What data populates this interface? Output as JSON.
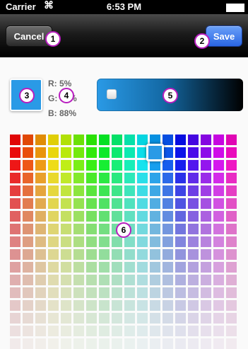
{
  "status_bar": {
    "carrier": "Carrier",
    "time": "6:53 PM"
  },
  "navbar": {
    "cancel_label": "Cancel",
    "save_label": "Save"
  },
  "color": {
    "hex": "#0de1e1",
    "r_label": "R: 5%",
    "g_label": "G: 88%",
    "b_label": "B: 88%",
    "brightness": 0.1
  },
  "palette": {
    "columns": 18,
    "rows": 17,
    "selected_column": 11,
    "selected_row": 1,
    "selected_color": "#2a9ae6"
  },
  "markers": [
    "1",
    "2",
    "3",
    "4",
    "5",
    "6"
  ]
}
